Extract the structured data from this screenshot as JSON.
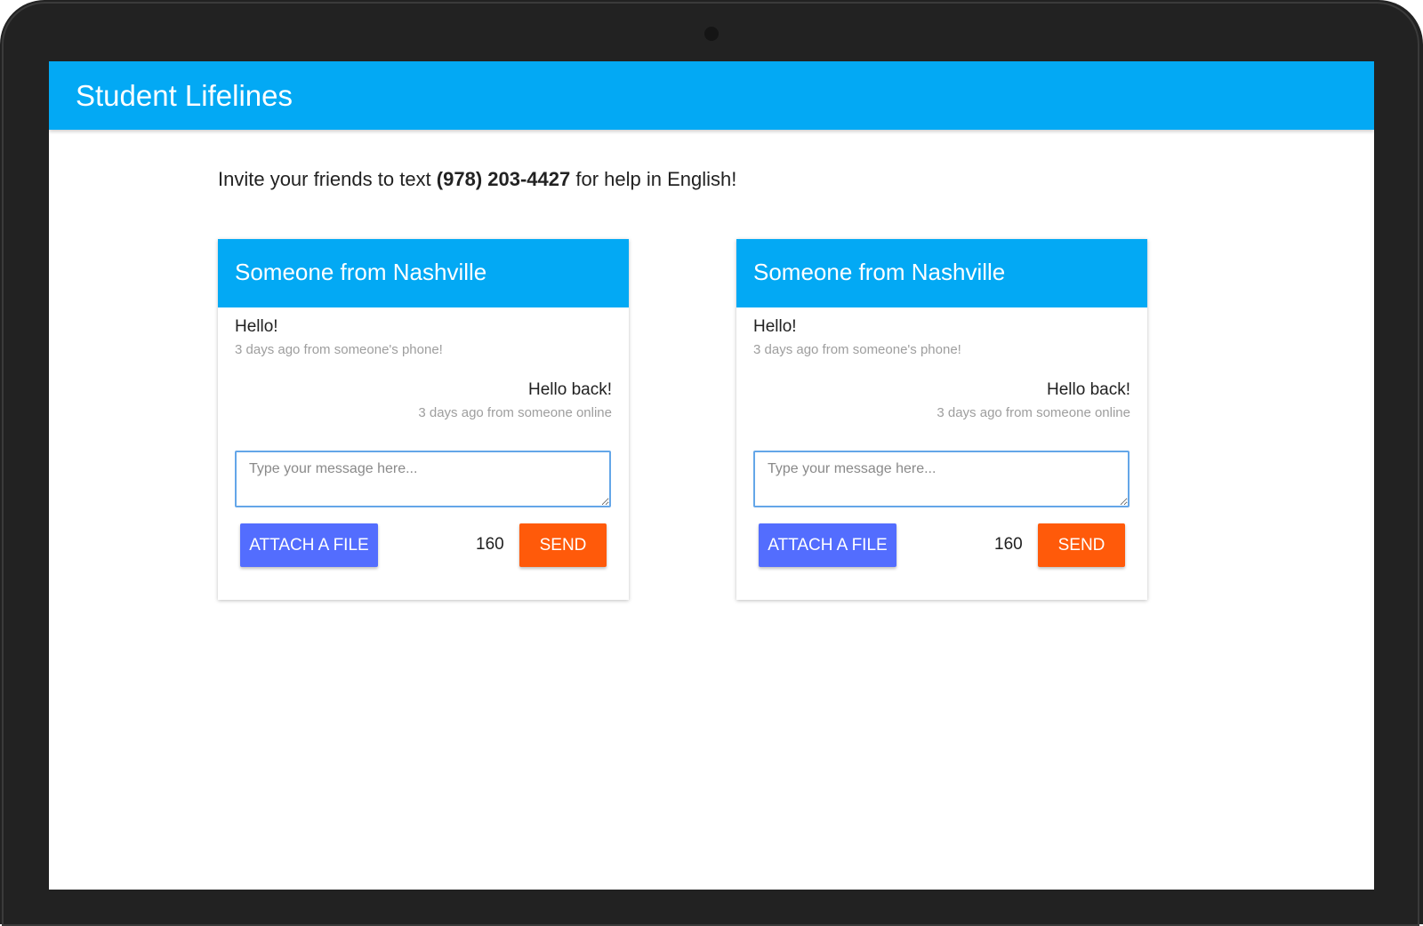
{
  "app": {
    "title": "Student Lifelines"
  },
  "invite": {
    "prefix": "Invite your friends to text ",
    "phone": "(978) 203-4427",
    "suffix": " for help in English!"
  },
  "colors": {
    "primary": "#03a9f4",
    "attach": "#536dfe",
    "send": "#ff5a0a"
  },
  "conversations": [
    {
      "title": "Someone from Nashville",
      "messages": [
        {
          "text": "Hello!",
          "meta": "3 days ago from someone's phone!",
          "direction": "incoming"
        },
        {
          "text": "Hello back!",
          "meta": "3 days ago from someone online",
          "direction": "outgoing"
        }
      ],
      "input_placeholder": "Type your message here...",
      "attach_label": "ATTACH A FILE",
      "char_count": "160",
      "send_label": "SEND"
    },
    {
      "title": "Someone from Nashville",
      "messages": [
        {
          "text": "Hello!",
          "meta": "3 days ago from someone's phone!",
          "direction": "incoming"
        },
        {
          "text": "Hello back!",
          "meta": "3 days ago from someone online",
          "direction": "outgoing"
        }
      ],
      "input_placeholder": "Type your message here...",
      "attach_label": "ATTACH A FILE",
      "char_count": "160",
      "send_label": "SEND"
    }
  ]
}
